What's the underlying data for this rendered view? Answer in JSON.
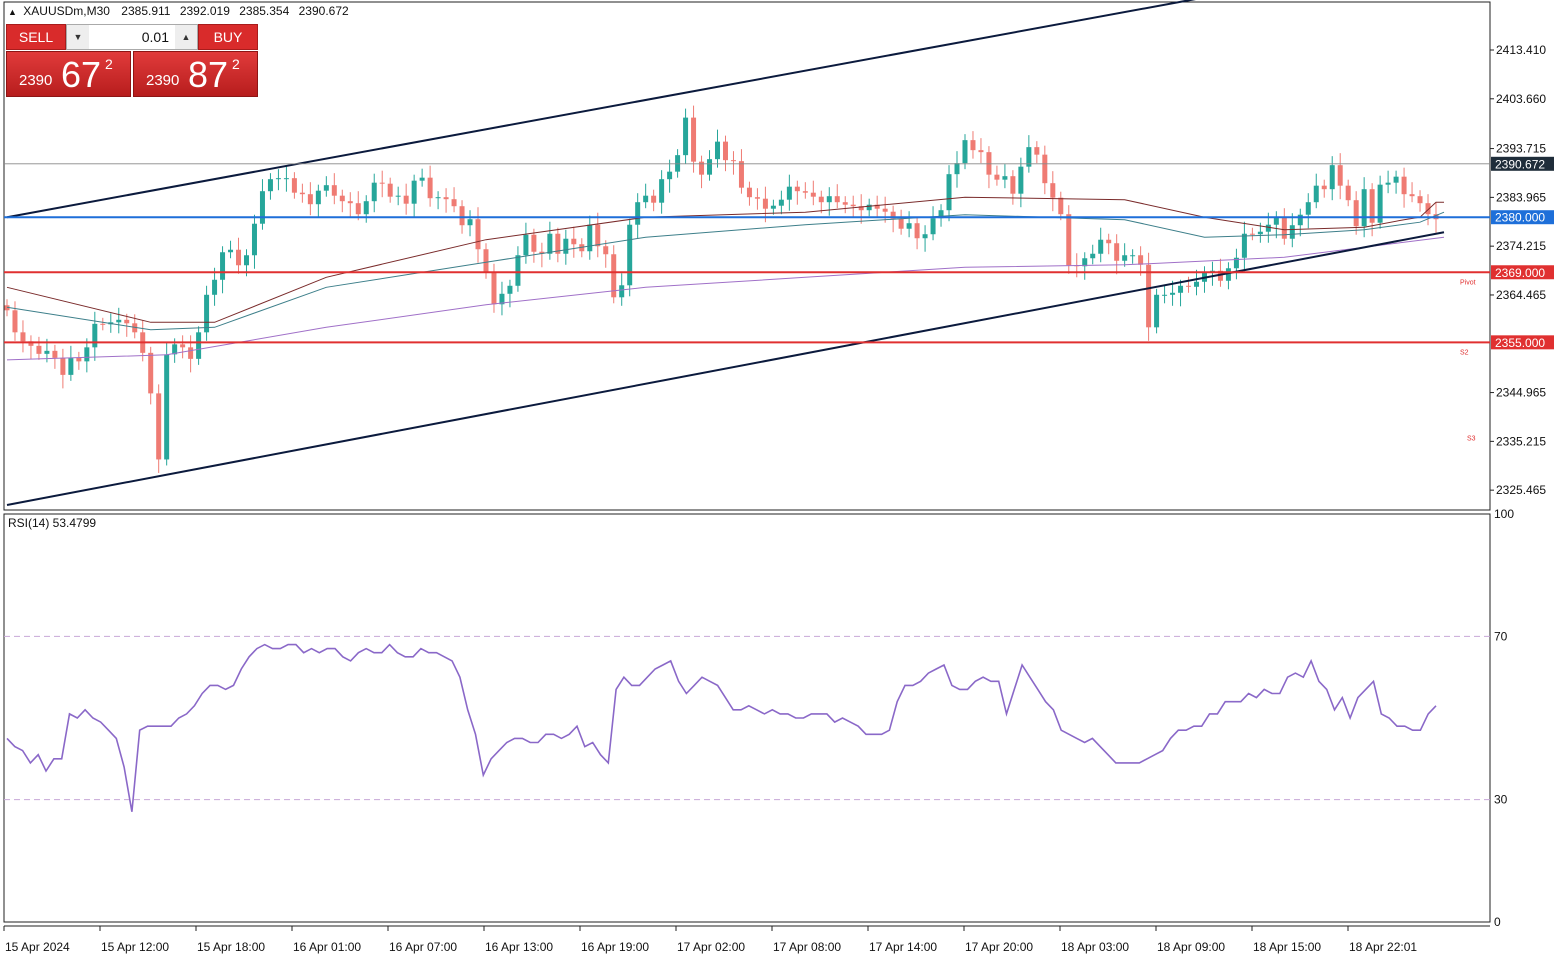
{
  "header": {
    "symbol": "XAUUSDm,M30",
    "open": "2385.911",
    "high": "2392.019",
    "low": "2385.354",
    "close": "2390.672"
  },
  "trade_panel": {
    "sell_label": "SELL",
    "buy_label": "BUY",
    "lot_value": "0.01",
    "sell_price_small": "2390",
    "sell_price_big": "67",
    "sell_price_sup": "2",
    "buy_price_small": "2390",
    "buy_price_big": "87",
    "buy_price_sup": "2"
  },
  "colors": {
    "bull": "#26a69a",
    "bear": "#ef7b73",
    "channel": "#0b1a3d",
    "resistance_blue": "#1e6fd9",
    "support_red": "#e03030",
    "ma_brown": "#7a2b2b",
    "ma_teal": "#3d7f8a",
    "ma_purple": "#a070c8",
    "rsi": "#8a68c8"
  },
  "chart_data": [
    {
      "type": "candlestick",
      "symbol": "XAUUSDm",
      "timeframe": "M30",
      "y_ticks": [
        "2413.410",
        "2403.660",
        "2393.715",
        "2383.965",
        "2374.215",
        "2364.465",
        "2344.965",
        "2335.215",
        "2325.465"
      ],
      "ylim": [
        2321.5,
        2423.0
      ],
      "x_tick_labels": [
        "15 Apr 2024",
        "15 Apr 12:00",
        "15 Apr 18:00",
        "16 Apr 01:00",
        "16 Apr 07:00",
        "16 Apr 13:00",
        "16 Apr 19:00",
        "17 Apr 02:00",
        "17 Apr 08:00",
        "17 Apr 14:00",
        "17 Apr 20:00",
        "18 Apr 03:00",
        "18 Apr 09:00",
        "18 Apr 15:00",
        "18 Apr 22:01"
      ],
      "bar_count": 180,
      "current_price": "2390.672",
      "horizontal_levels": [
        {
          "price": "2380.000",
          "color": "blue"
        },
        {
          "price": "2369.000",
          "color": "red",
          "label": "Pivot"
        },
        {
          "price": "2355.000",
          "color": "red",
          "label": "S2"
        }
      ],
      "level_labels": [
        {
          "text": "S3",
          "price": 2336.0
        }
      ],
      "channel": {
        "upper": [
          {
            "bar": 0,
            "price": 2380.0
          },
          {
            "bar": 152,
            "price": 2424.5
          }
        ],
        "lower": [
          {
            "bar": 0,
            "price": 2322.5
          },
          {
            "bar": 180,
            "price": 2377.0
          }
        ]
      },
      "closes": [
        2361.4,
        2357.0,
        2355.2,
        2354.3,
        2352.7,
        2353.3,
        2351.9,
        2348.5,
        2351.9,
        2351.2,
        2354.0,
        2358.7,
        2358.6,
        2359.0,
        2359.5,
        2358.8,
        2357.0,
        2352.9,
        2344.8,
        2331.6,
        2352.6,
        2354.6,
        2354.0,
        2351.7,
        2357.0,
        2364.5,
        2367.5,
        2373.0,
        2373.5,
        2370.4,
        2372.4,
        2378.7,
        2385.2,
        2387.6,
        2387.8,
        2387.8,
        2384.9,
        2384.6,
        2382.6,
        2385.3,
        2386.4,
        2384.3,
        2383.2,
        2382.8,
        2380.6,
        2383.2,
        2386.9,
        2386.7,
        2384.1,
        2384.3,
        2382.7,
        2387.3,
        2387.9,
        2383.8,
        2384.0,
        2383.6,
        2382.2,
        2378.4,
        2379.6,
        2373.6,
        2368.9,
        2362.6,
        2364.7,
        2366.3,
        2372.4,
        2376.5,
        2373.1,
        2372.7,
        2376.7,
        2372.7,
        2375.7,
        2374.6,
        2373.2,
        2378.5,
        2374.2,
        2372.6,
        2364.0,
        2366.4,
        2378.5,
        2383.0,
        2384.3,
        2382.9,
        2387.6,
        2389.1,
        2392.4,
        2399.9,
        2391.1,
        2388.5,
        2391.6,
        2395.1,
        2391.4,
        2391.2,
        2385.9,
        2384.0,
        2383.7,
        2381.7,
        2382.3,
        2383.5,
        2386.1,
        2385.2,
        2384.9,
        2384.1,
        2383.0,
        2384.2,
        2383.0,
        2382.5,
        2382.2,
        2381.4,
        2382.5,
        2381.7,
        2381.1,
        2379.7,
        2377.7,
        2378.8,
        2375.8,
        2376.6,
        2379.8,
        2381.4,
        2388.6,
        2390.8,
        2395.4,
        2393.4,
        2393.0,
        2388.5,
        2387.5,
        2388.2,
        2384.7,
        2390.1,
        2394.0,
        2392.5,
        2386.8,
        2383.9,
        2380.6,
        2370.4,
        2370.2,
        2371.8,
        2372.7,
        2375.5,
        2374.8,
        2371.3,
        2372.4,
        2372.4,
        2370.5,
        2358.0,
        2364.5,
        2364.5,
        2364.9,
        2366.3,
        2366.1,
        2367.1,
        2369.0,
        2369.3,
        2367.3,
        2369.8,
        2371.9,
        2376.7,
        2376.6,
        2377.1,
        2378.5,
        2380.0,
        2375.7,
        2378.4,
        2380.5,
        2383.0,
        2386.3,
        2385.6,
        2390.4,
        2386.3,
        2383.4,
        2378.2,
        2385.6,
        2378.9,
        2386.5,
        2386.9,
        2388.1,
        2384.6,
        2384.2,
        2382.8,
        2380.6,
        2379.6,
        2377.5,
        2378.8,
        2380.2,
        2377.2,
        2377.6,
        2380.8
      ],
      "moving_averages": [
        {
          "color": "brown",
          "points": [
            [
              0,
              2366
            ],
            [
              18,
              2359
            ],
            [
              26,
              2359
            ],
            [
              40,
              2368
            ],
            [
              60,
              2375.5
            ],
            [
              80,
              2380
            ],
            [
              100,
              2381
            ],
            [
              120,
              2384
            ],
            [
              140,
              2383.5
            ],
            [
              150,
              2380
            ],
            [
              160,
              2377.5
            ],
            [
              170,
              2378
            ],
            [
              175,
              2379.5
            ],
            [
              177,
              2380
            ],
            [
              179,
              2383
            ],
            [
              180,
              2383
            ]
          ]
        },
        {
          "color": "teal",
          "points": [
            [
              0,
              2362
            ],
            [
              18,
              2357.5
            ],
            [
              26,
              2358
            ],
            [
              40,
              2366
            ],
            [
              60,
              2371
            ],
            [
              80,
              2376
            ],
            [
              100,
              2378.5
            ],
            [
              120,
              2380.5
            ],
            [
              140,
              2379.5
            ],
            [
              150,
              2376
            ],
            [
              160,
              2376.5
            ],
            [
              170,
              2377.5
            ],
            [
              177,
              2379
            ],
            [
              180,
              2381
            ]
          ]
        },
        {
          "color": "purple",
          "points": [
            [
              0,
              2351.5
            ],
            [
              20,
              2352.5
            ],
            [
              40,
              2358
            ],
            [
              60,
              2362.5
            ],
            [
              80,
              2366
            ],
            [
              100,
              2368
            ],
            [
              120,
              2370
            ],
            [
              140,
              2370.5
            ],
            [
              160,
              2372
            ],
            [
              180,
              2376
            ]
          ]
        }
      ]
    },
    {
      "type": "line",
      "name": "RSI(14)",
      "title": "RSI(14) 53.4799",
      "y_ticks": [
        "100",
        "70",
        "30",
        "0"
      ],
      "ylim": [
        0,
        100
      ],
      "levels": [
        70,
        30
      ],
      "values": [
        45,
        43,
        42,
        39,
        41,
        37,
        40,
        40,
        51,
        50,
        52,
        50,
        49,
        47,
        45,
        38,
        27,
        47,
        48,
        48,
        48,
        48,
        50,
        51,
        53,
        56,
        58,
        58,
        57,
        58,
        62,
        65,
        67,
        68,
        67,
        67,
        68,
        68,
        66,
        67,
        66,
        67,
        67,
        65,
        64,
        66,
        67,
        66,
        66,
        68,
        66,
        65,
        65,
        67,
        66,
        66,
        65,
        64,
        60,
        52,
        46,
        36,
        40,
        42,
        44,
        45,
        45,
        44,
        44,
        46,
        46,
        45,
        46,
        48,
        43,
        44,
        41,
        39,
        57,
        60,
        58,
        58,
        60,
        62,
        63,
        64,
        59,
        56,
        58,
        60,
        59,
        58,
        55,
        52,
        52,
        53,
        52,
        51,
        52,
        51,
        51,
        50,
        50,
        51,
        51,
        51,
        49,
        50,
        49,
        48,
        46,
        46,
        46,
        47,
        54,
        58,
        58,
        59,
        61,
        62,
        63,
        58,
        57,
        57,
        59,
        60,
        59,
        59,
        51,
        57,
        63,
        60,
        57,
        54,
        52,
        47,
        46,
        45,
        44,
        45,
        43,
        41,
        39,
        39,
        39,
        39,
        40,
        41,
        42,
        45,
        47,
        47,
        48,
        48,
        51,
        51,
        54,
        54,
        54,
        56,
        55,
        57,
        56,
        56,
        60,
        61,
        60,
        64,
        59,
        57,
        52,
        55,
        50,
        55,
        57,
        59,
        51,
        50,
        48,
        48,
        47,
        47,
        51,
        53
      ],
      "last_value": 53.4799
    }
  ]
}
